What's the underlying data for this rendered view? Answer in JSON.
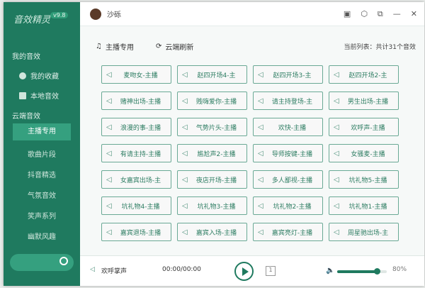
{
  "app": {
    "logo_text": "音效精灵",
    "version": "v9.8"
  },
  "sidebar": {
    "my_sounds": "我的音效",
    "favorites": "我的收藏",
    "local": "本地音效",
    "cloud": "云端音效",
    "items": [
      "主播专用",
      "歌曲片段",
      "抖音精选",
      "气氛音效",
      "笑声系列",
      "幽默风趣"
    ],
    "selected": 0
  },
  "header": {
    "username": "沙砾",
    "controls": [
      "skin-icon",
      "settings-icon",
      "mini-mode-icon",
      "minimize-icon",
      "close-icon"
    ]
  },
  "toolbar": {
    "category": "主播专用",
    "refresh": "云端刷新",
    "count": "当前列表：共计31个音效"
  },
  "sounds": [
    "麦吻女-主播",
    "赵四开场4-主",
    "赵四开场3-主",
    "赵四开场2-主",
    "赌神出场-主播",
    "贱嗨爱你-主播",
    "请主持登场-主",
    "男生出场-主播",
    "浪漫的事-主播",
    "气势片头-主播",
    "欢快-主播",
    "欢呼声-主播",
    "有请主持-主播",
    "尴尬声2-主播",
    "导师按键-主播",
    "女骚麦-主播",
    "女嘉宾出场-主",
    "夜店开场-主播",
    "多人鄙视-主播",
    "坑礼物5-主播",
    "坑礼物4-主播",
    "坑礼物3-主播",
    "坑礼物2-主播",
    "坑礼物1-主播",
    "嘉宾退场-主播",
    "嘉宾入场-主播",
    "嘉宾亮灯-主播",
    "周星驰出场-主"
  ],
  "player": {
    "current": "欢呼掌声",
    "time": "00:00/00:00",
    "loop": "1",
    "volume_label": "80%",
    "volume": 80
  },
  "colors": {
    "primary": "#1f7a5f",
    "accent": "#35a07f"
  }
}
